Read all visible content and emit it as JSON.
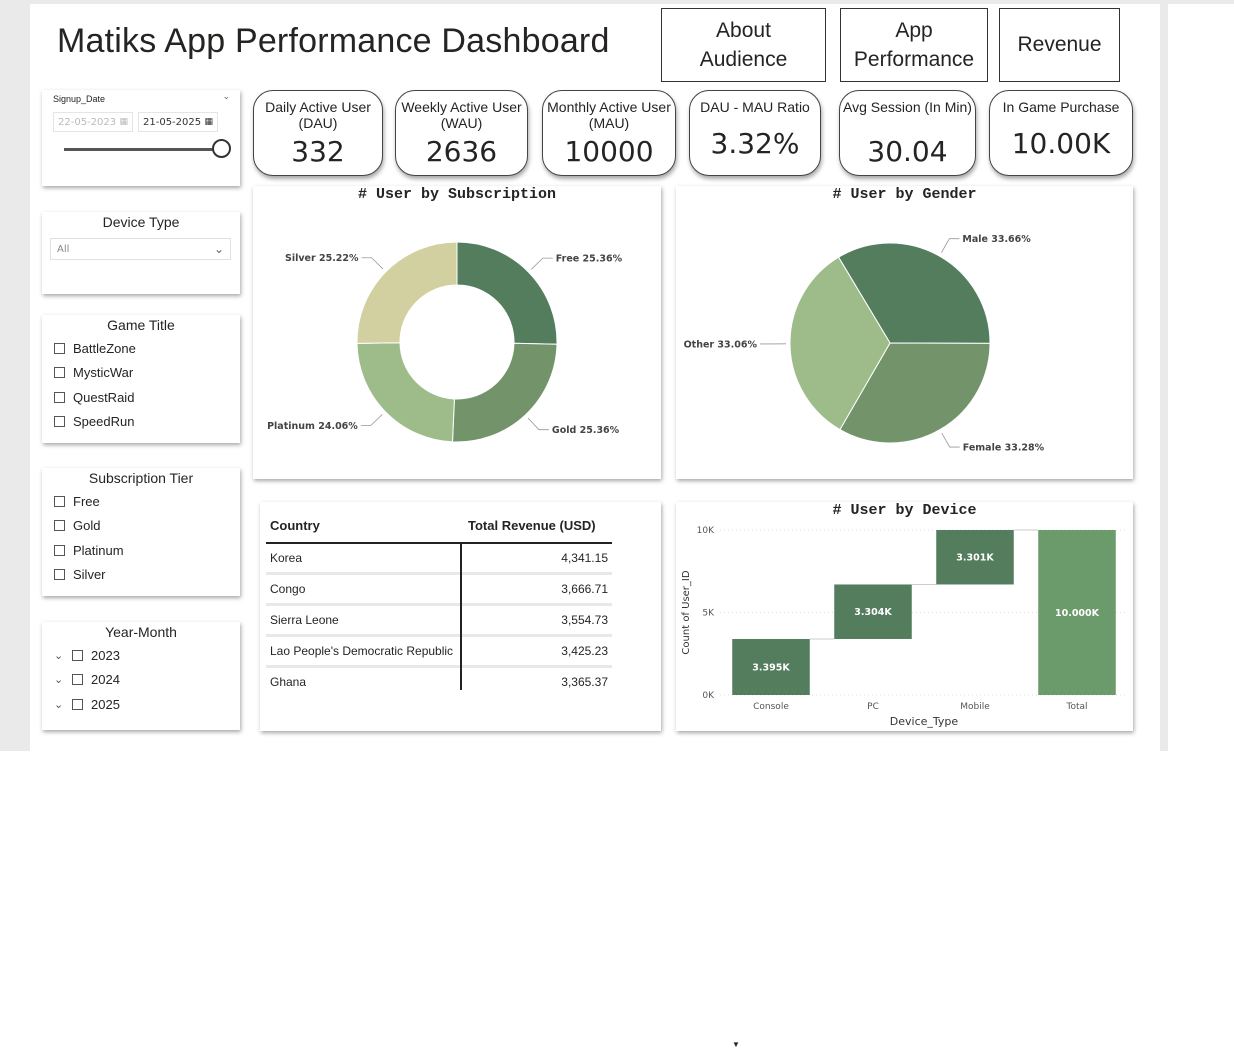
{
  "title": "Matiks App Performance Dashboard",
  "nav": {
    "about": "About\nAudience",
    "performance": "App\nPerformance",
    "revenue": "Revenue"
  },
  "date_slicer": {
    "label": "Signup_Date",
    "start": "22-05-2023",
    "end": "21-05-2025"
  },
  "device_slicer": {
    "title": "Device Type",
    "selected": "All"
  },
  "game_slicer": {
    "title": "Game Title",
    "items": [
      "BattleZone",
      "MysticWar",
      "QuestRaid",
      "SpeedRun"
    ]
  },
  "tier_slicer": {
    "title": "Subscription Tier",
    "items": [
      "Free",
      "Gold",
      "Platinum",
      "Silver"
    ]
  },
  "year_slicer": {
    "title": "Year-Month",
    "items": [
      "2023",
      "2024",
      "2025"
    ]
  },
  "kpis": [
    {
      "label": "Daily Active User (DAU)",
      "value": "332"
    },
    {
      "label": "Weekly Active User (WAU)",
      "value": "2636"
    },
    {
      "label": "Monthly Active User (MAU)",
      "value": "10000"
    },
    {
      "label": "DAU - MAU Ratio",
      "value": "3.32%"
    },
    {
      "label": "Avg Session (In Min)",
      "value": "30.04"
    },
    {
      "label": "In Game Purchase",
      "value": "10.00K"
    }
  ],
  "table": {
    "headers": [
      "Country",
      "Total Revenue (USD)"
    ],
    "rows": [
      [
        "Korea",
        "4,341.15"
      ],
      [
        "Congo",
        "3,666.71"
      ],
      [
        "Sierra Leone",
        "3,554.73"
      ],
      [
        "Lao People's Democratic Republic",
        "3,425.23"
      ],
      [
        "Ghana",
        "3,365.37"
      ]
    ]
  },
  "colors": {
    "dark_green": "#537d5d",
    "mid_green": "#73946b",
    "light_green": "#9ebc8a",
    "khaki": "#d2d0a0",
    "total_green": "#6b9a6b"
  },
  "chart_data": [
    {
      "type": "pie",
      "variant": "donut",
      "title": "# User by Subscription",
      "slices": [
        {
          "label": "Free",
          "value": 25.36,
          "display": "Free 25.36%"
        },
        {
          "label": "Gold",
          "value": 25.36,
          "display": "Gold 25.36%"
        },
        {
          "label": "Platinum",
          "value": 24.06,
          "display": "Platinum 24.06%"
        },
        {
          "label": "Silver",
          "value": 25.22,
          "display": "Silver 25.22%"
        }
      ]
    },
    {
      "type": "pie",
      "title": "# User by Gender",
      "slices": [
        {
          "label": "Male",
          "value": 33.66,
          "display": "Male 33.66%"
        },
        {
          "label": "Female",
          "value": 33.28,
          "display": "Female 33.28%"
        },
        {
          "label": "Other",
          "value": 33.06,
          "display": "Other 33.06%"
        }
      ]
    },
    {
      "type": "bar",
      "variant": "waterfall",
      "title": "# User by Device",
      "xlabel": "Device_Type",
      "ylabel": "Count of User_ID",
      "categories": [
        "Console",
        "PC",
        "Mobile",
        "Total"
      ],
      "values": [
        3395,
        3304,
        3301,
        10000
      ],
      "data_labels": [
        "3.395K",
        "3.304K",
        "3.301K",
        "10.000K"
      ],
      "yticks": [
        {
          "v": 0,
          "t": "0K"
        },
        {
          "v": 5000,
          "t": "5K"
        },
        {
          "v": 10000,
          "t": "10K"
        }
      ],
      "ylim": [
        0,
        10000
      ]
    }
  ]
}
